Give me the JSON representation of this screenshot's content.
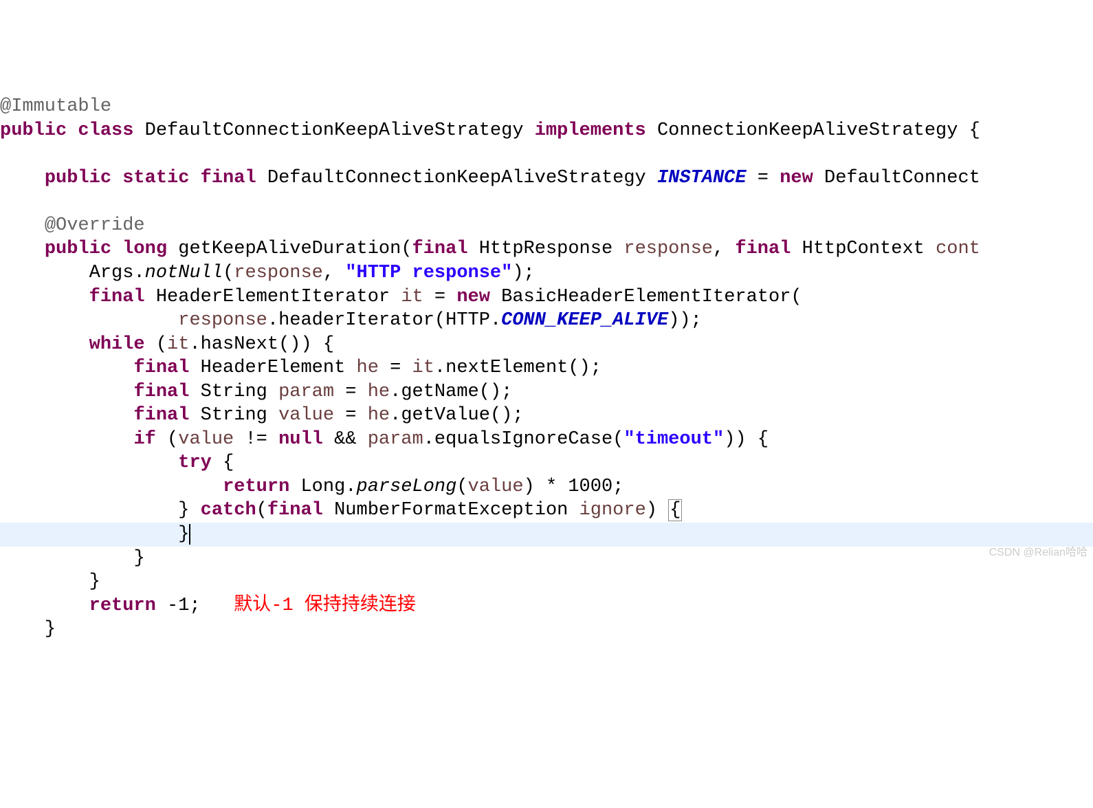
{
  "code": {
    "annotation_immutable": "@Immutable",
    "kw_public": "public",
    "kw_class": "class",
    "class_name": "DefaultConnectionKeepAliveStrategy",
    "kw_implements": "implements",
    "interface_name": "ConnectionKeepAliveStrategy",
    "brace_open": "{",
    "brace_close": "}",
    "kw_static": "static",
    "kw_final": "final",
    "type_dkas": "DefaultConnectionKeepAliveStrategy",
    "field_instance": "INSTANCE",
    "eq": "=",
    "kw_new": "new",
    "new_expr": "DefaultConnect",
    "annotation_override": "@Override",
    "kw_long": "long",
    "method_name": "getKeepAliveDuration",
    "open_paren": "(",
    "close_paren": ")",
    "type_httpresponse": "HttpResponse",
    "param_response": "response",
    "comma": ",",
    "type_httpcontext": "HttpContext",
    "param_cont": "cont",
    "class_args": "Args",
    "dot": ".",
    "method_notnull": "notNull",
    "arg_response": "response",
    "str_http_response": "\"HTTP response\"",
    "semi": ";",
    "type_hei": "HeaderElementIterator",
    "var_it": "it",
    "type_bhei": "BasicHeaderElementIterator",
    "method_headeriter": "headerIterator",
    "class_http": "HTTP",
    "const_conn_keep_alive": "CONN_KEEP_ALIVE",
    "double_close_paren_semi": "));",
    "kw_while": "while",
    "expr_it": "it",
    "method_hasnext": "hasNext",
    "empty_args": "()",
    "type_he": "HeaderElement",
    "var_he": "he",
    "method_nextelement": "nextElement",
    "type_string": "String",
    "var_param": "param",
    "method_getname": "getName",
    "var_value": "value",
    "method_getvalue": "getValue",
    "kw_if": "if",
    "ne": "!=",
    "kw_null": "null",
    "and": "&&",
    "method_eqignorecase": "equalsIgnoreCase",
    "str_timeout": "\"timeout\"",
    "kw_try": "try",
    "kw_return": "return",
    "class_long": "Long",
    "method_parselong": "parseLong",
    "mult": "*",
    "num_1000": "1000",
    "kw_catch": "catch",
    "type_nfe": "NumberFormatException",
    "param_ignore": "ignore",
    "return_neg1": "-1",
    "comment_default": "默认-1 保持持续连接"
  },
  "watermark": "CSDN @Relian哈哈"
}
